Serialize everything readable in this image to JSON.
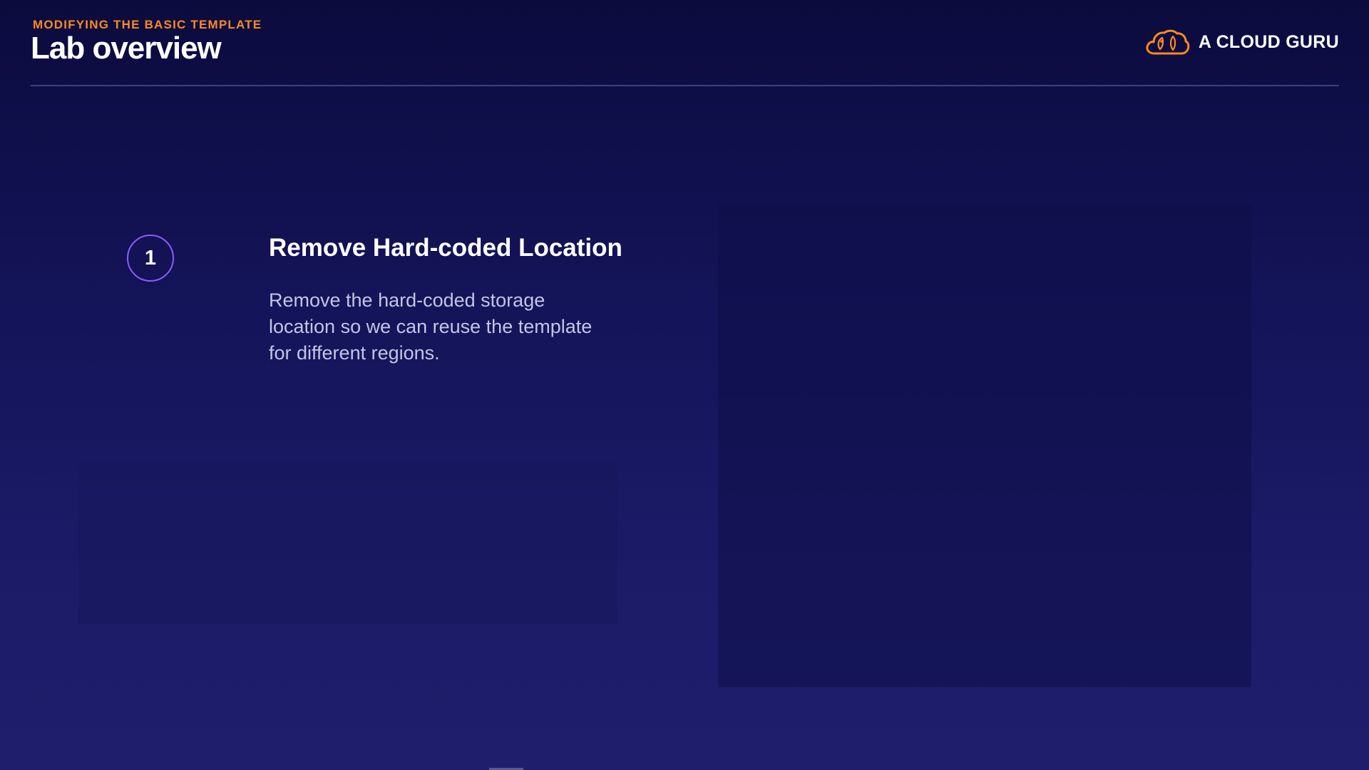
{
  "header": {
    "eyebrow": "MODIFYING THE BASIC TEMPLATE",
    "title": "Lab overview"
  },
  "brand": {
    "logo_icon": "cloud-face-icon",
    "name": "A CLOUD GURU"
  },
  "step": {
    "number": "1",
    "title": "Remove Hard-coded Location",
    "description": "Remove the hard-coded storage location so we can reuse the template for different regions."
  },
  "colors": {
    "background_top": "#0b0b3e",
    "background_bottom": "#1e1e6c",
    "accent_orange": "#ff8a1e",
    "badge_purple": "#8b5cf6",
    "body_text": "#c3c5e3"
  }
}
